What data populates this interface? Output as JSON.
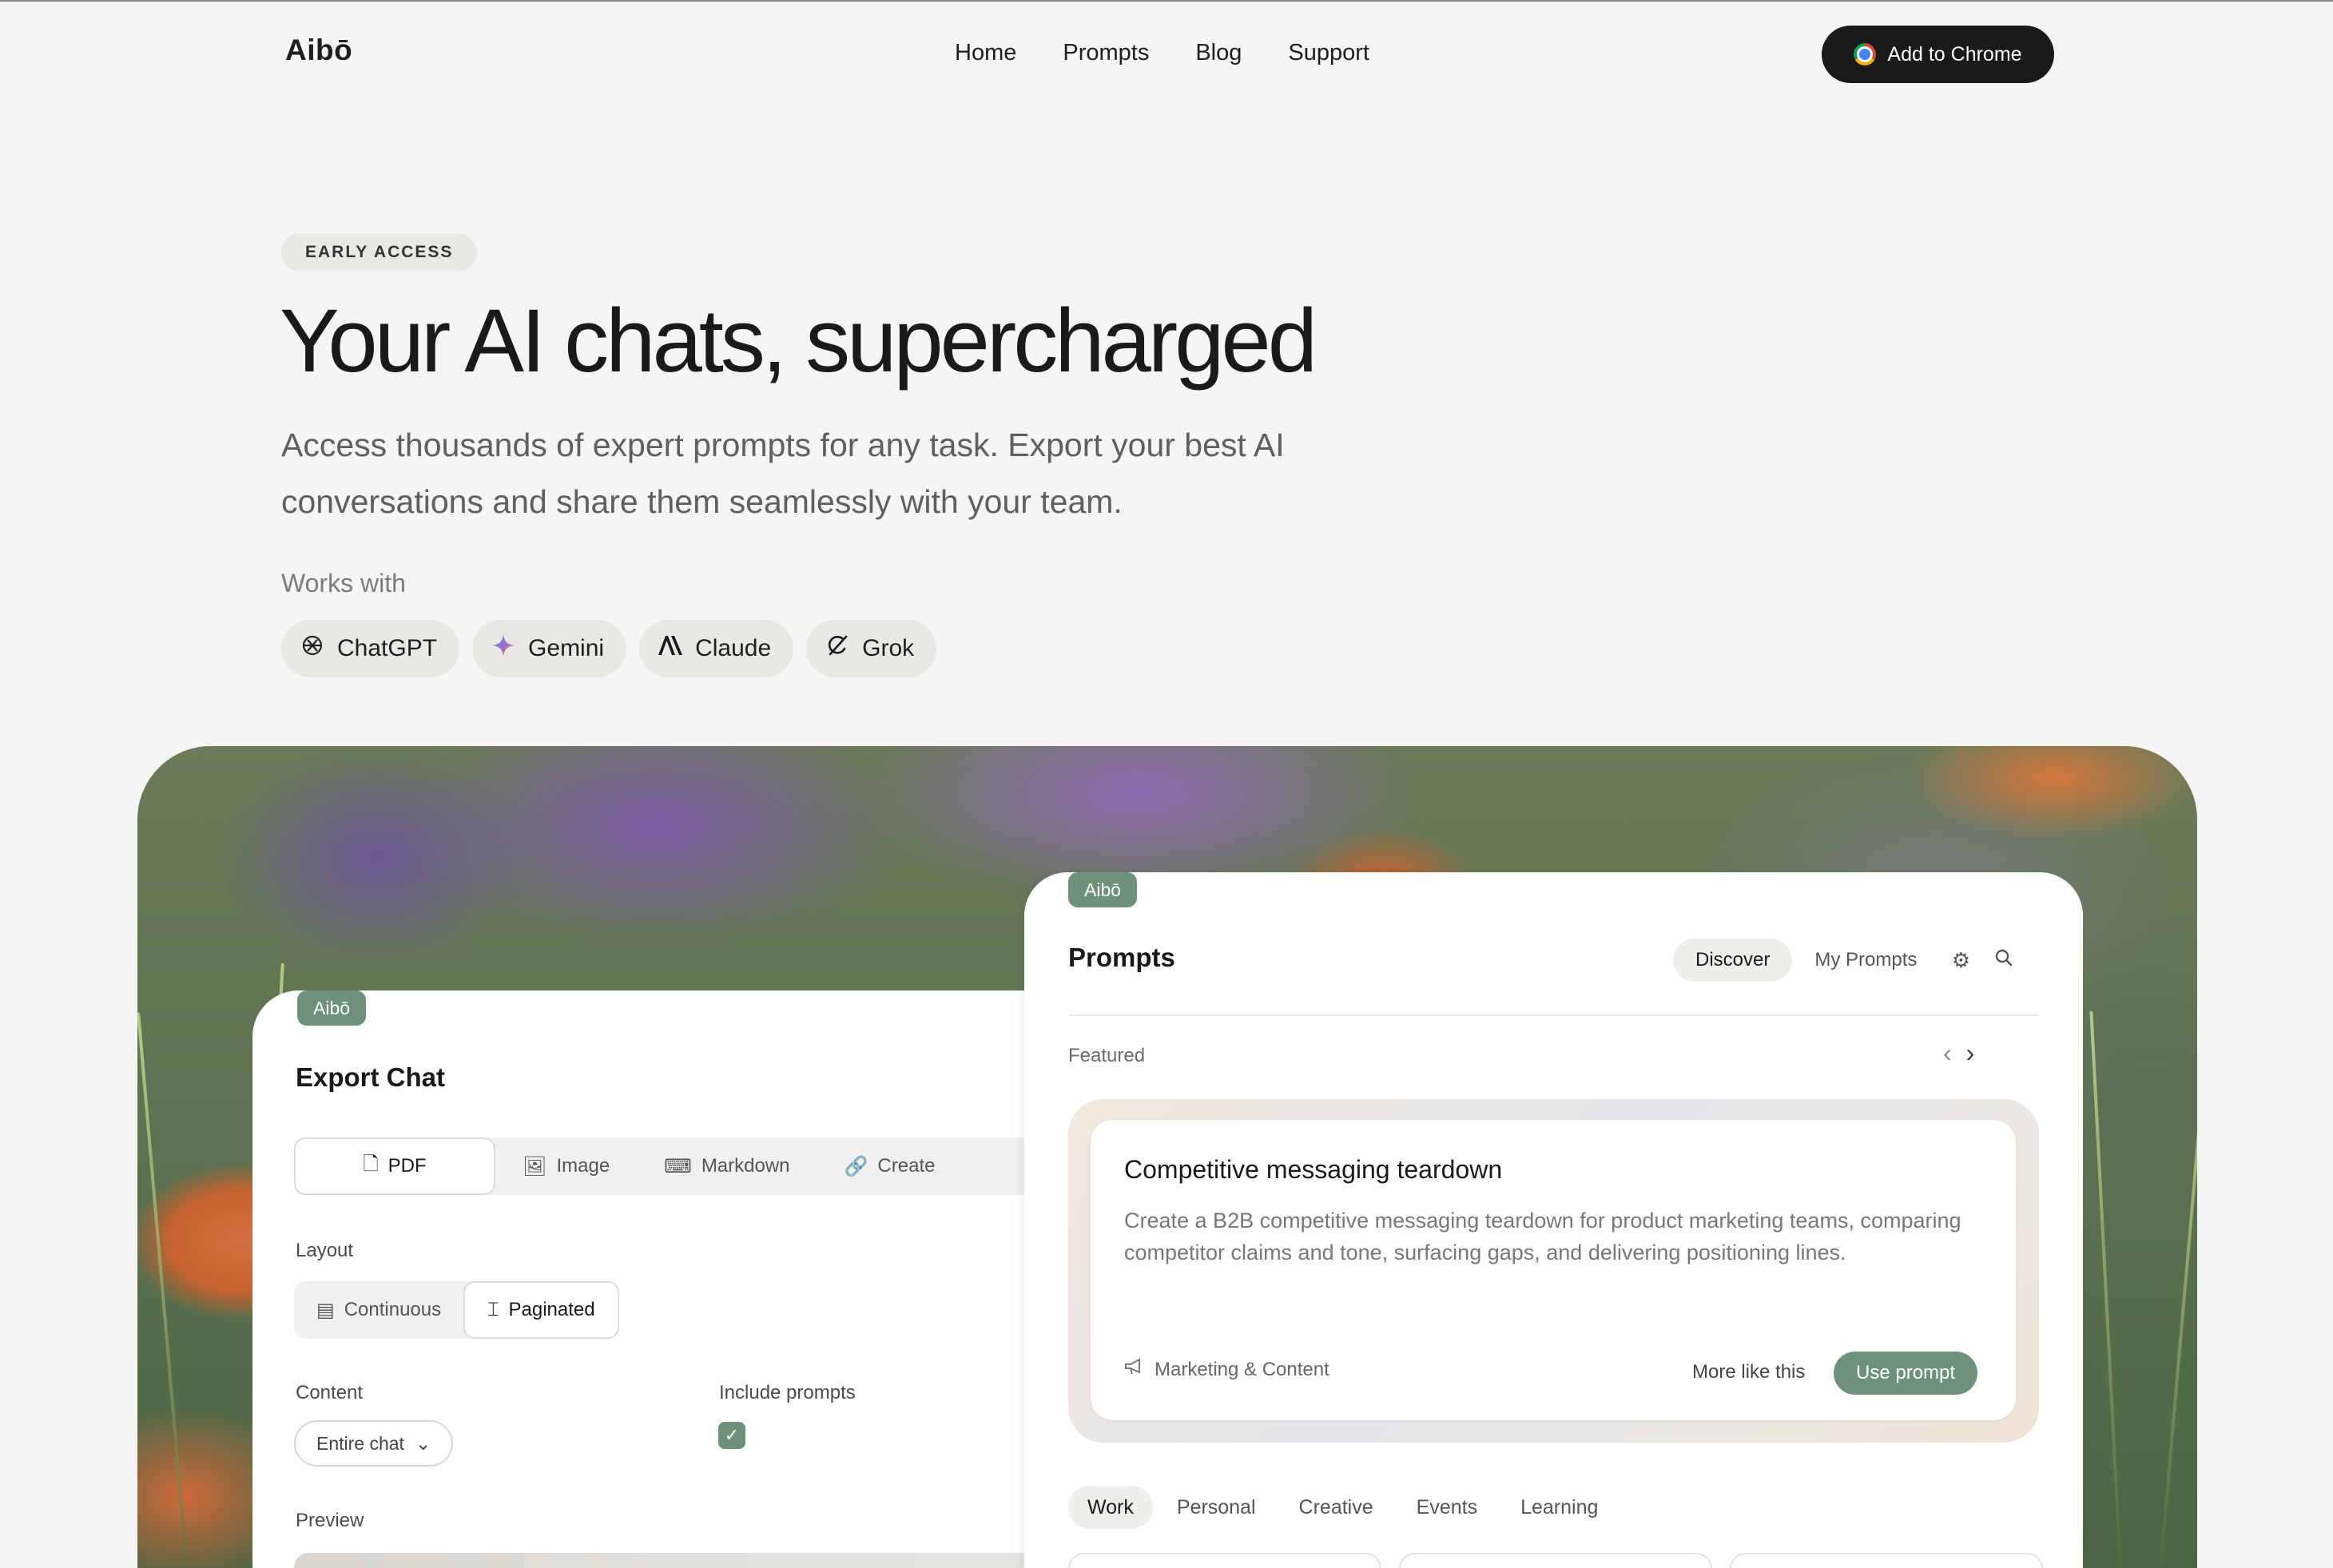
{
  "nav": {
    "logo": "Aibō",
    "links": [
      "Home",
      "Prompts",
      "Blog",
      "Support"
    ],
    "cta": "Add to Chrome"
  },
  "hero": {
    "badge": "EARLY ACCESS",
    "headline": "Your AI chats, supercharged",
    "subtext": "Access thousands of expert prompts for any task. Export your best AI conversations and share them seamlessly with your team.",
    "works_with_label": "Works with",
    "integrations": [
      {
        "name": "ChatGPT",
        "icon": "chatgpt-icon"
      },
      {
        "name": "Gemini",
        "icon": "gemini-icon"
      },
      {
        "name": "Claude",
        "icon": "claude-icon"
      },
      {
        "name": "Grok",
        "icon": "grok-icon"
      }
    ]
  },
  "export_panel": {
    "tag": "Aibō",
    "title": "Export Chat",
    "formats": [
      {
        "label": "PDF",
        "icon": "file-icon",
        "selected": true
      },
      {
        "label": "Image",
        "icon": "image-icon",
        "selected": false
      },
      {
        "label": "Markdown",
        "icon": "markdown-icon",
        "selected": false
      },
      {
        "label": "Create",
        "icon": "link-icon",
        "selected": false
      }
    ],
    "layout_label": "Layout",
    "layout_options": [
      {
        "label": "Continuous",
        "icon": "document-icon",
        "selected": false
      },
      {
        "label": "Paginated",
        "icon": "pages-icon",
        "selected": true
      }
    ],
    "content_label": "Content",
    "content_value": "Entire chat",
    "include_prompts_label": "Include prompts",
    "include_prompts_checked": true,
    "preview_label": "Preview"
  },
  "prompts_panel": {
    "tag": "Aibō",
    "title": "Prompts",
    "tabs": [
      {
        "label": "Discover",
        "selected": true
      },
      {
        "label": "My Prompts",
        "selected": false
      }
    ],
    "featured_label": "Featured",
    "featured_card": {
      "title": "Competitive messaging teardown",
      "description": "Create a B2B competitive messaging teardown for product marketing teams, comparing competitor claims and tone, surfacing gaps, and delivering positioning lines.",
      "category": "Marketing & Content",
      "more_label": "More like this",
      "use_label": "Use prompt"
    },
    "categories": [
      {
        "label": "Work",
        "selected": true
      },
      {
        "label": "Personal",
        "selected": false
      },
      {
        "label": "Creative",
        "selected": false
      },
      {
        "label": "Events",
        "selected": false
      },
      {
        "label": "Learning",
        "selected": false
      }
    ]
  },
  "colors": {
    "accent": "#6e9179",
    "background": "#f6f5f3",
    "dark_button": "#1a1a1a"
  }
}
